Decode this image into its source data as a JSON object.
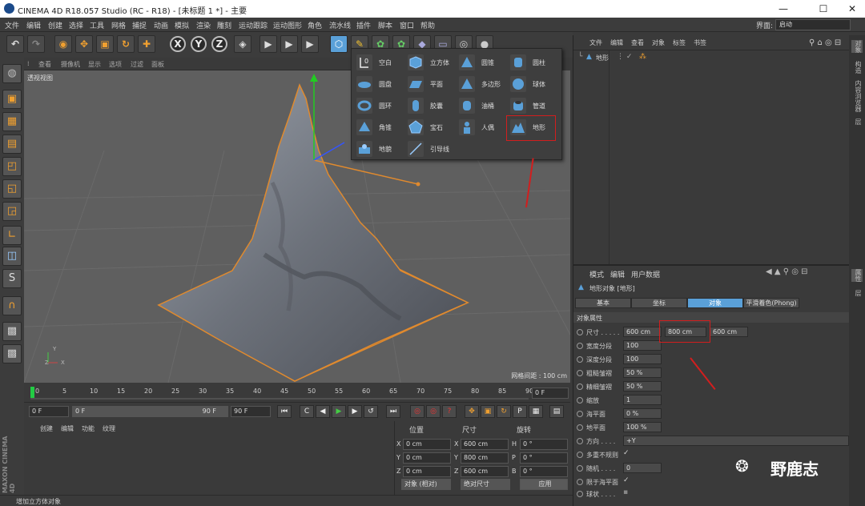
{
  "window": {
    "title": "CINEMA 4D R18.057 Studio (RC - R18) - [未标题 1 *] - 主要"
  },
  "menubar": {
    "items": [
      "文件",
      "编辑",
      "创建",
      "选择",
      "工具",
      "网格",
      "捕捉",
      "动画",
      "模拟",
      "渲染",
      "雕刻",
      "运动跟踪",
      "运动图形",
      "角色",
      "流水线",
      "插件",
      "脚本",
      "窗口",
      "帮助"
    ],
    "interface_label": "界面:",
    "interface_value": "启动"
  },
  "toolbar": {
    "axis_x": "X",
    "axis_y": "Y",
    "axis_z": "Z"
  },
  "viewport": {
    "menu": [
      "查看",
      "摄像机",
      "显示",
      "选项",
      "过滤",
      "面板"
    ],
    "label": "透视视图",
    "grid_info": "网格间距 : 100 cm"
  },
  "popup": {
    "items": [
      {
        "label": "空白",
        "icon": "null-icon"
      },
      {
        "label": "立方体",
        "icon": "cube-icon"
      },
      {
        "label": "圆锥",
        "icon": "cone-icon"
      },
      {
        "label": "圆柱",
        "icon": "cylinder-icon"
      },
      {
        "label": "圆盘",
        "icon": "disc-icon"
      },
      {
        "label": "平面",
        "icon": "plane-icon"
      },
      {
        "label": "多边形",
        "icon": "polygon-icon"
      },
      {
        "label": "球体",
        "icon": "sphere-icon"
      },
      {
        "label": "圆环",
        "icon": "torus-icon"
      },
      {
        "label": "胶囊",
        "icon": "capsule-icon"
      },
      {
        "label": "油桶",
        "icon": "oil-tank-icon"
      },
      {
        "label": "管道",
        "icon": "tube-icon"
      },
      {
        "label": "角锥",
        "icon": "pyramid-icon"
      },
      {
        "label": "宝石",
        "icon": "platonic-icon"
      },
      {
        "label": "人偶",
        "icon": "figure-icon"
      },
      {
        "label": "地形",
        "icon": "landscape-icon"
      },
      {
        "label": "地貌",
        "icon": "relief-icon"
      },
      {
        "label": "引导线",
        "icon": "guide-icon"
      }
    ]
  },
  "timeline": {
    "ticks": [
      "0",
      "5",
      "10",
      "15",
      "20",
      "25",
      "30",
      "35",
      "40",
      "45",
      "50",
      "55",
      "60",
      "65",
      "70",
      "75",
      "80",
      "85",
      "90"
    ],
    "current": "0 F"
  },
  "playbar": {
    "start": "0 F",
    "min": "0 F",
    "max_slider": "90 F",
    "end": "90 F"
  },
  "material_menu": [
    "创建",
    "编辑",
    "功能",
    "纹理"
  ],
  "coords": {
    "headers": [
      "位置",
      "尺寸",
      "旋转"
    ],
    "rows": [
      {
        "a": "X",
        "pos": "0 cm",
        "b": "X",
        "size": "600 cm",
        "c": "H",
        "rot": "0 °"
      },
      {
        "a": "Y",
        "pos": "0 cm",
        "b": "Y",
        "size": "800 cm",
        "c": "P",
        "rot": "0 °"
      },
      {
        "a": "Z",
        "pos": "0 cm",
        "b": "Z",
        "size": "600 cm",
        "c": "B",
        "rot": "0 °"
      }
    ],
    "mode_object": "对象 (相对)",
    "mode_size": "绝对尺寸",
    "apply": "应用"
  },
  "status": "增加立方体对象",
  "brand": "MAXON CINEMA 4D",
  "object_manager": {
    "menu": [
      "文件",
      "编辑",
      "查看",
      "对象",
      "标签",
      "书签"
    ],
    "object_name": "地形"
  },
  "attributes": {
    "menu": [
      "模式",
      "编辑",
      "用户数据"
    ],
    "title": "地形对象 [地形]",
    "tabs": [
      "基本",
      "坐标",
      "对象",
      "平滑着色(Phong)"
    ],
    "section": "对象属性",
    "size_label": "尺寸 . . . . .",
    "size_x": "600 cm",
    "size_y": "800 cm",
    "size_z": "600 cm",
    "props": [
      {
        "label": "宽度分段",
        "value": "100"
      },
      {
        "label": "深度分段",
        "value": "100"
      },
      {
        "label": "粗糙皱褶",
        "value": "50 %"
      },
      {
        "label": "精细皱褶",
        "value": "50 %"
      },
      {
        "label": "缩放",
        "value": "1"
      },
      {
        "label": "海平面",
        "value": "0 %"
      },
      {
        "label": "地平面",
        "value": "100 %"
      }
    ],
    "direction_label": "方向 . . . .",
    "direction_value": "+Y",
    "multi_irregular": "多重不规则",
    "random_label": "随机 . . . .",
    "random_value": "0",
    "limit_sea": "限于海平面",
    "spherical": "球状 . . . ."
  },
  "right_tabs": [
    "对象",
    "构造",
    "内容浏览器",
    "层"
  ],
  "right_tabs_lower": [
    "属性",
    "层"
  ],
  "watermark": "野鹿志"
}
